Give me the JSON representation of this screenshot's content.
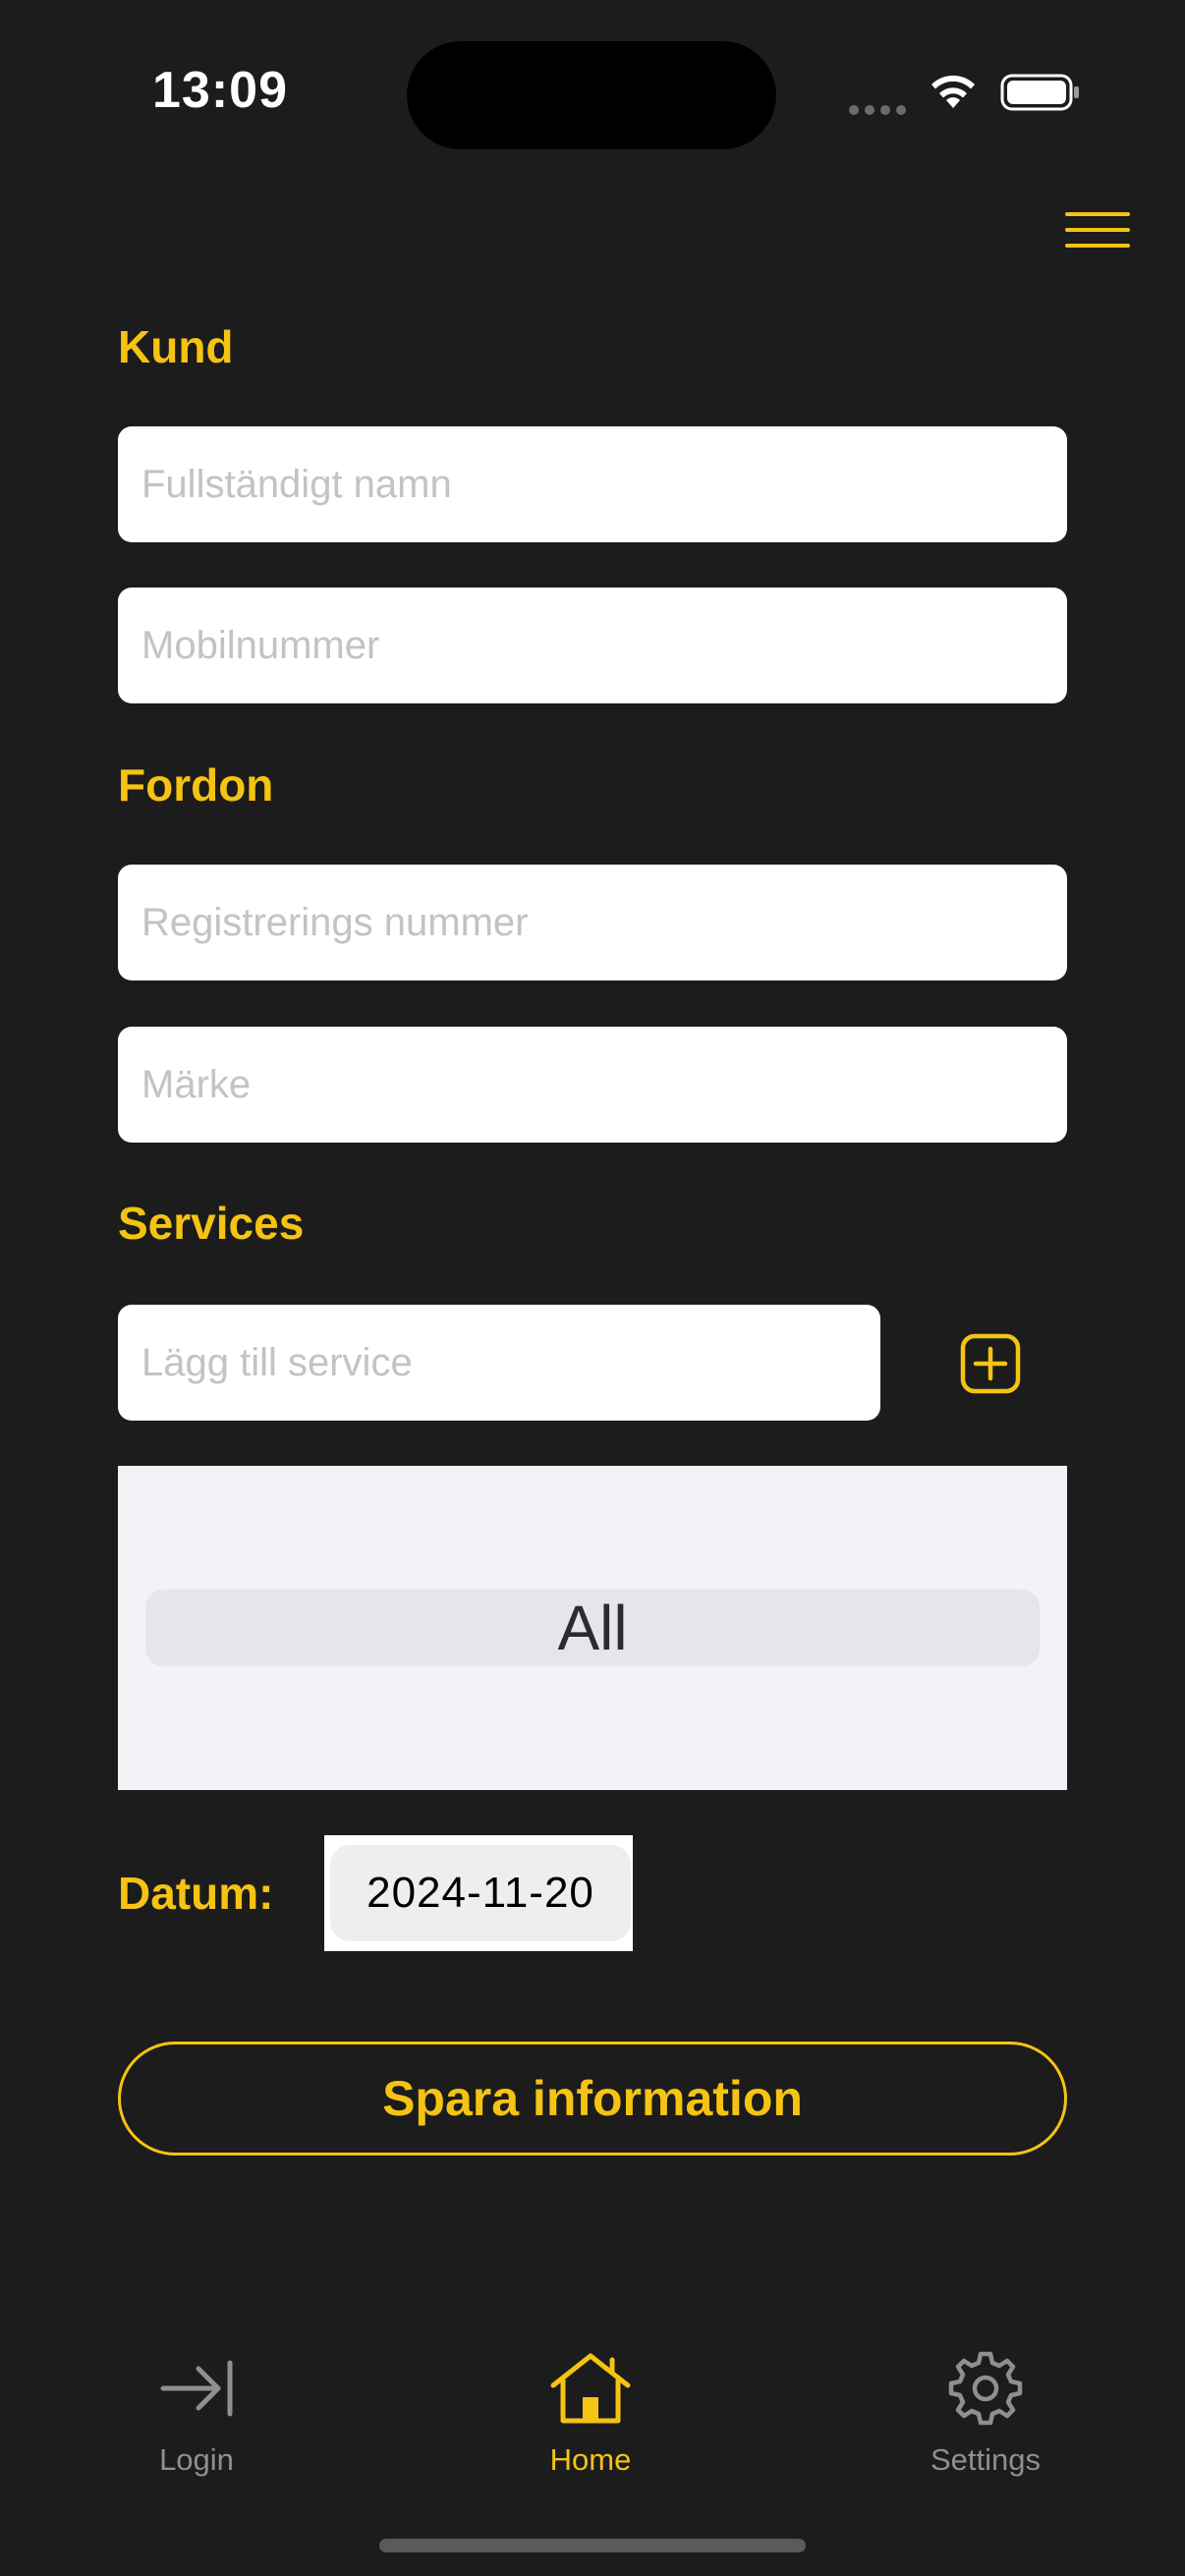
{
  "status_bar": {
    "time": "13:09"
  },
  "header": {
    "menu_icon": "hamburger-menu-icon"
  },
  "sections": {
    "customer_title": "Kund",
    "vehicle_title": "Fordon",
    "services_title": "Services"
  },
  "fields": {
    "full_name": {
      "placeholder": "Fullständigt namn",
      "value": ""
    },
    "phone": {
      "placeholder": "Mobilnummer",
      "value": ""
    },
    "registration": {
      "placeholder": "Registrerings nummer",
      "value": ""
    },
    "brand": {
      "placeholder": "Märke",
      "value": ""
    },
    "service": {
      "placeholder": "Lägg till service",
      "value": ""
    }
  },
  "services_picker": {
    "selected": "All"
  },
  "date": {
    "label": "Datum:",
    "value": "2024-11-20"
  },
  "save_button": {
    "label": "Spara information"
  },
  "tab_bar": {
    "items": [
      {
        "label": "Login",
        "icon": "login-arrow-icon",
        "active": false
      },
      {
        "label": "Home",
        "icon": "house-icon",
        "active": true
      },
      {
        "label": "Settings",
        "icon": "gear-icon",
        "active": false
      }
    ]
  },
  "colors": {
    "background": "#1c1c1c",
    "accent": "#f5c313",
    "inactive_tab": "#8e8e93"
  }
}
